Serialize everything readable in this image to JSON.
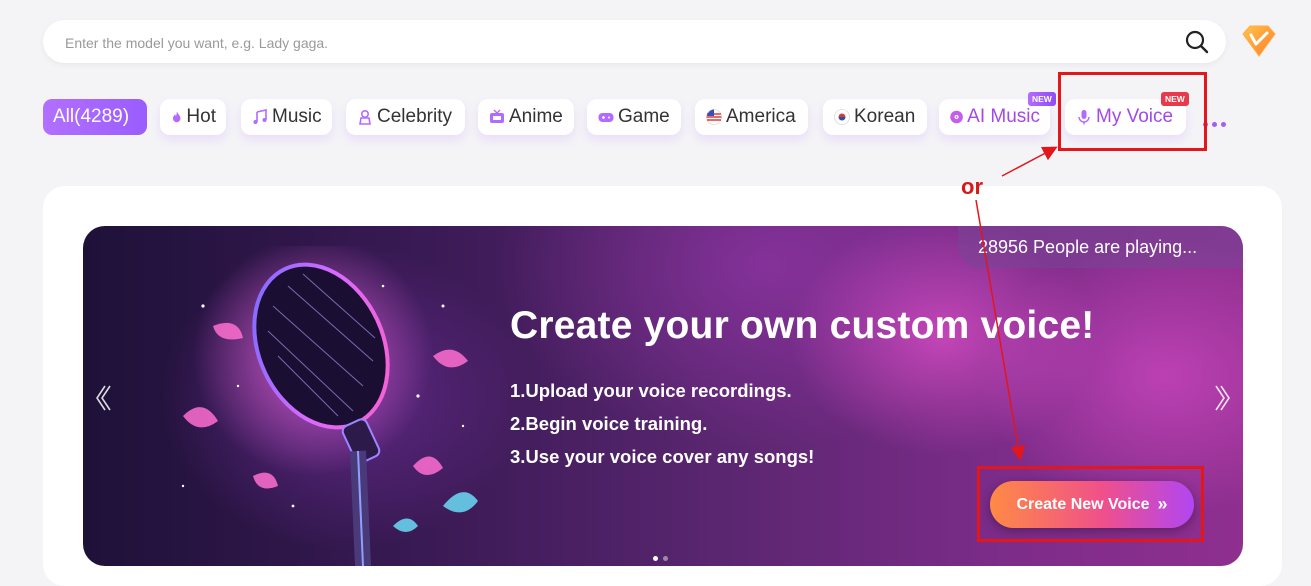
{
  "search": {
    "placeholder": "Enter the model you want, e.g. Lady gaga."
  },
  "categories": [
    {
      "label": "All(4289)"
    },
    {
      "label": "Hot"
    },
    {
      "label": "Music"
    },
    {
      "label": "Celebrity"
    },
    {
      "label": "Anime"
    },
    {
      "label": "Game"
    },
    {
      "label": "America"
    },
    {
      "label": "Korean"
    },
    {
      "label": "AI Music",
      "badge": "NEW"
    },
    {
      "label": "My Voice",
      "badge": "NEW"
    }
  ],
  "banner": {
    "playing": "28956 People are playing...",
    "headline": "Create your own custom voice!",
    "steps": [
      "1.Upload your voice recordings.",
      "2.Begin voice training.",
      "3.Use your voice cover any songs!"
    ],
    "cta_label": "Create New Voice",
    "cta_chevron": "»"
  },
  "annotation": {
    "or_label": "or"
  },
  "colors": {
    "accent": "#9b5cff",
    "annotation": "#e3161c",
    "cta_start": "#ff8a45",
    "cta_end": "#b146f2"
  }
}
